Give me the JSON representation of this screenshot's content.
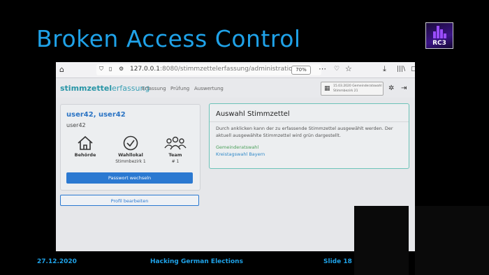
{
  "slide": {
    "title": "Broken Access Control",
    "logo_text": "RC3",
    "footer": {
      "date": "27.12.2020",
      "talk": "Hacking German Elections",
      "slide": "Slide 18"
    },
    "accent": "#1fa2e8"
  },
  "browser": {
    "url_host": "127.0.0.1",
    "url_path": ":8080/stimmzettelerfassung/administration",
    "zoom": "70%"
  },
  "app": {
    "brand_left": "stimmzettel",
    "brand_right": "erfassung",
    "nav": [
      "Erfassung",
      "Prüfung",
      "Auswertung"
    ],
    "election_line1": "15.03.2020 Gemeinderatswahl",
    "election_line2": "Stimmbezirk 21"
  },
  "user_card": {
    "display_name": "user42, user42",
    "username": "user42",
    "stats": [
      {
        "label": "Behörde",
        "value": "",
        "icon": "building-icon"
      },
      {
        "label": "Wahllokal",
        "value": "Stimmbezirk 1",
        "icon": "check-circle-icon"
      },
      {
        "label": "Team",
        "value": "# 1",
        "icon": "group-icon"
      }
    ],
    "change_password_label": "Passwort wechseln",
    "edit_profile_label": "Profil bearbeiten"
  },
  "ballot_card": {
    "title": "Auswahl Stimmzettel",
    "description": "Durch anklicken kann der zu erfassende Stimmzettel ausgewählt werden. Der aktuell ausgewählte Stimmzettel wird grün dargestellt.",
    "options": [
      "Gemeinderatswahl",
      "Kreistagswahl Bayern"
    ]
  }
}
